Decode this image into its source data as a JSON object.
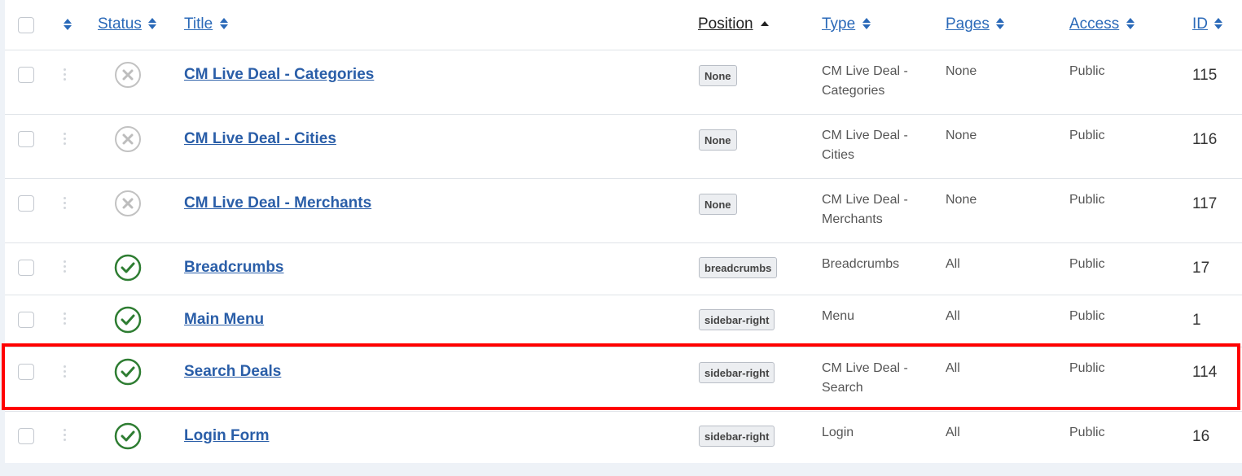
{
  "header": {
    "status": "Status",
    "title": "Title",
    "position": "Position",
    "type": "Type",
    "pages": "Pages",
    "access": "Access",
    "id": "ID"
  },
  "rows": [
    {
      "title": "CM Live Deal - Categories",
      "published": false,
      "position": "None",
      "type_line1": "CM Live Deal -",
      "type_line2": "Categories",
      "pages": "None",
      "access": "Public",
      "id": "115"
    },
    {
      "title": "CM Live Deal - Cities",
      "published": false,
      "position": "None",
      "type_line1": "CM Live Deal -",
      "type_line2": "Cities",
      "pages": "None",
      "access": "Public",
      "id": "116"
    },
    {
      "title": "CM Live Deal - Merchants",
      "published": false,
      "position": "None",
      "type_line1": "CM Live Deal -",
      "type_line2": "Merchants",
      "pages": "None",
      "access": "Public",
      "id": "117"
    },
    {
      "title": "Breadcrumbs",
      "published": true,
      "position": "breadcrumbs",
      "type_line1": "Breadcrumbs",
      "type_line2": "",
      "pages": "All",
      "access": "Public",
      "id": "17"
    },
    {
      "title": "Main Menu",
      "published": true,
      "position": "sidebar-right",
      "type_line1": "Menu",
      "type_line2": "",
      "pages": "All",
      "access": "Public",
      "id": "1"
    },
    {
      "title": "Search Deals",
      "published": true,
      "position": "sidebar-right",
      "type_line1": "CM Live Deal -",
      "type_line2": "Search",
      "pages": "All",
      "access": "Public",
      "id": "114"
    },
    {
      "title": "Login Form",
      "published": true,
      "position": "sidebar-right",
      "type_line1": "Login",
      "type_line2": "",
      "pages": "All",
      "access": "Public",
      "id": "16"
    }
  ],
  "icons": {
    "sort": "sort-icon",
    "sort_asc": "caret-up-icon",
    "published": "check-circle-icon",
    "unpublished": "x-circle-icon",
    "drag": "drag-handle-icon"
  },
  "colors": {
    "link": "#2a5ea8",
    "published": "#2e7d32",
    "unpublished": "#bdbdbd",
    "highlight": "#ff0000"
  }
}
